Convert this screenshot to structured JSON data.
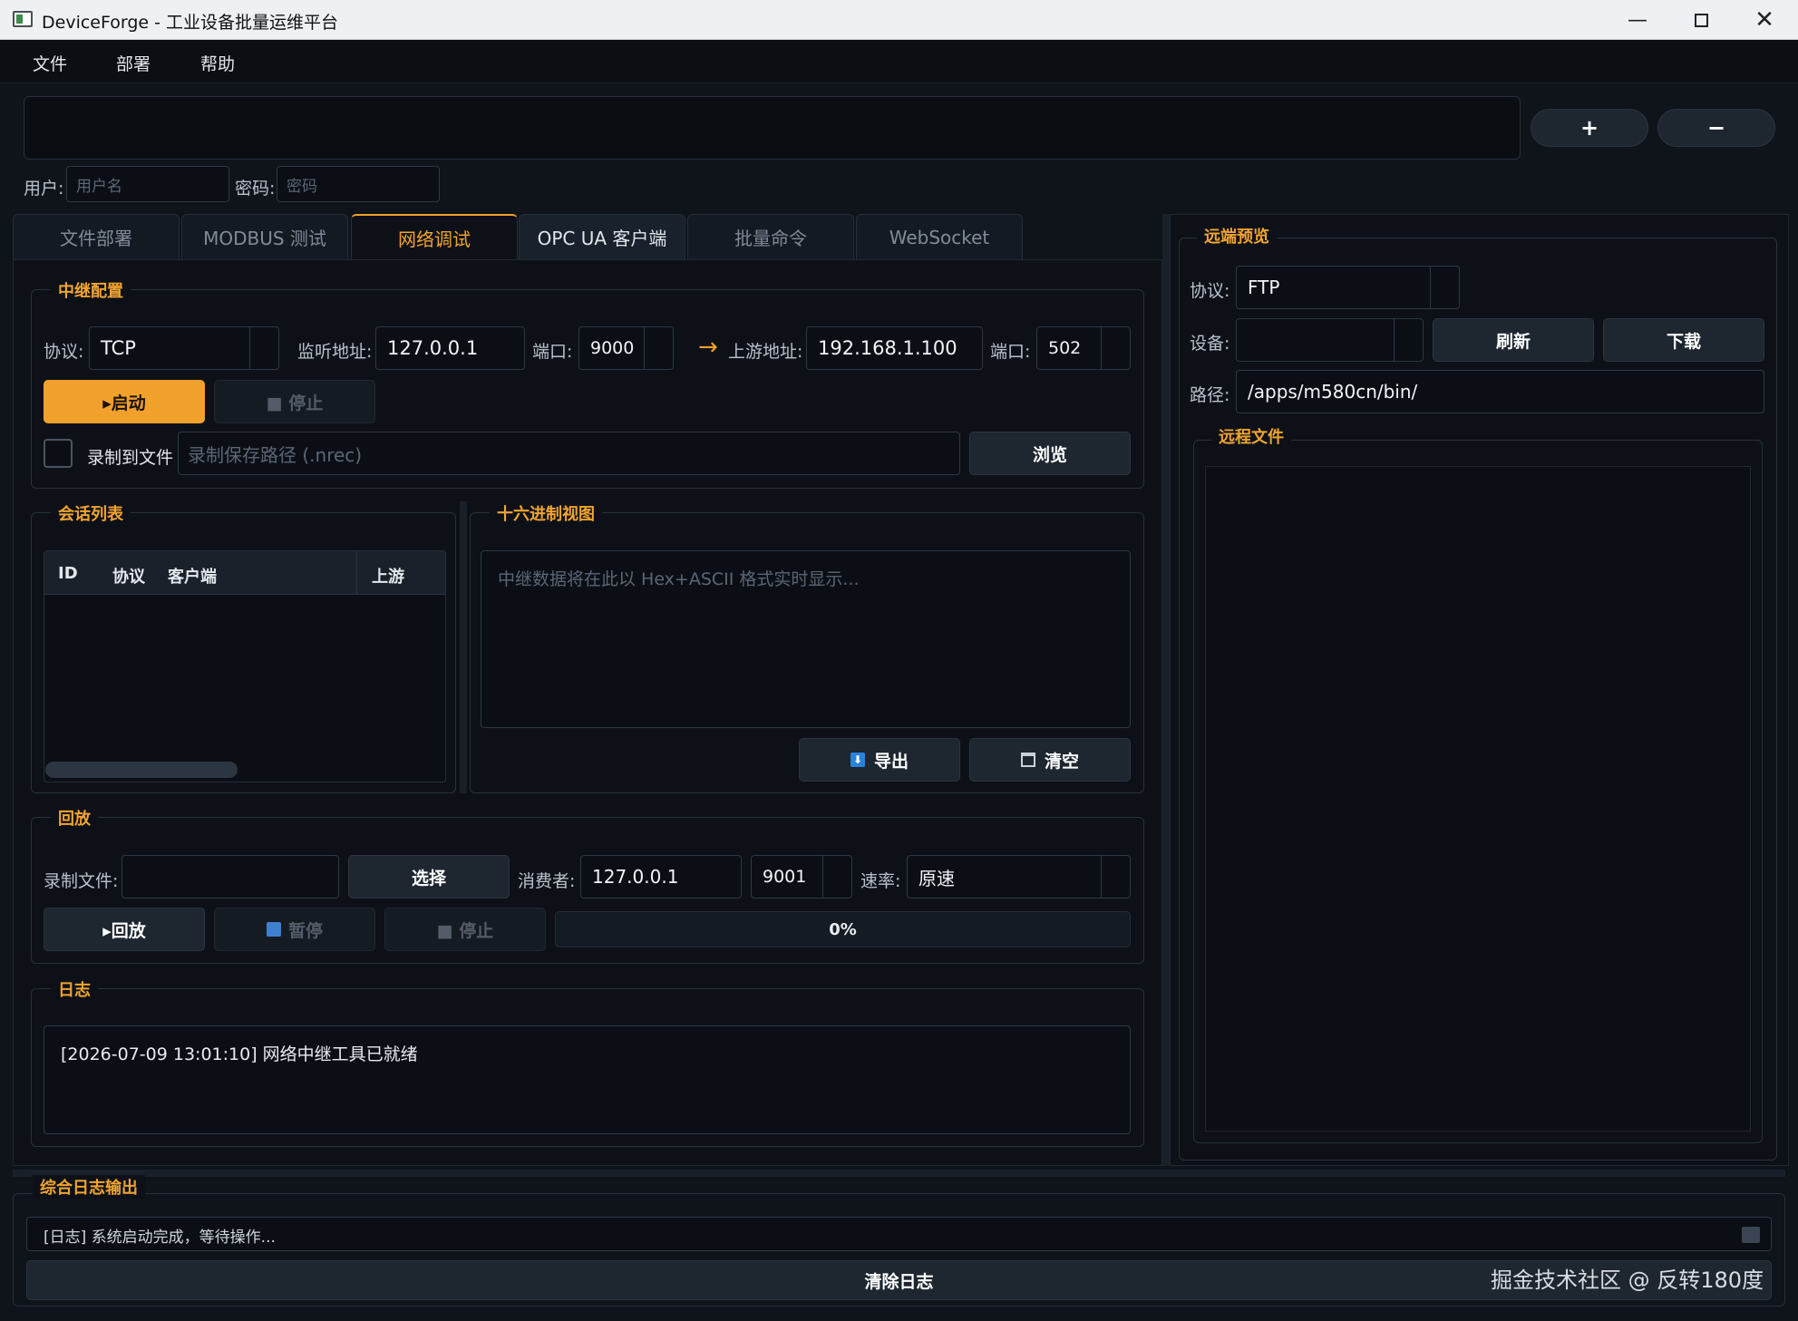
{
  "window": {
    "title": "DeviceForge - 工业设备批量运维平台"
  },
  "menu": [
    "文件",
    "部署",
    "帮助"
  ],
  "device_bar": {
    "add_label": "+",
    "remove_label": "−",
    "user_label": "用户:",
    "user_placeholder": "用户名",
    "password_label": "密码:",
    "password_placeholder": "密码"
  },
  "tabs": [
    {
      "label": "文件部署"
    },
    {
      "label": "MODBUS 测试"
    },
    {
      "label": "网络调试"
    },
    {
      "label": "OPC UA 客户端"
    },
    {
      "label": "批量命令"
    },
    {
      "label": "WebSocket"
    }
  ],
  "relay": {
    "title": "中继配置",
    "protocol_label": "协议:",
    "protocol_value": "TCP",
    "listen_label": "监听地址:",
    "listen_value": "127.0.0.1",
    "port_label": "端口:",
    "port_value": "9000",
    "arrow": "→",
    "upstream_label": "上游地址:",
    "upstream_value": "192.168.1.100",
    "upstream_port_label": "端口:",
    "upstream_port_value": "502",
    "start_label": "▸启动",
    "stop_label": "■ 停止",
    "record_label": "录制到文件",
    "record_placeholder": "录制保存路径 (.nrec)",
    "browse_label": "浏览"
  },
  "sessions": {
    "title": "会话列表",
    "columns": [
      "ID",
      "协议",
      "客户端",
      "上游"
    ]
  },
  "hex": {
    "title": "十六进制视图",
    "placeholder": "中继数据将在此以 Hex+ASCII 格式实时显示...",
    "export_label": "导出",
    "clear_label": "清空"
  },
  "replay": {
    "title": "回放",
    "file_label": "录制文件:",
    "select_label": "选择",
    "consumer_label": "消费者:",
    "consumer_host": "127.0.0.1",
    "consumer_port": "9001",
    "speed_label": "速率:",
    "speed_value": "原速",
    "play_label": "▸回放",
    "pause_label": "暂停",
    "stop_label": "■ 停止",
    "progress_text": "0%",
    "progress": 0
  },
  "log": {
    "title": "日志",
    "lines": [
      "[2026-07-09 13:01:10] 网络中继工具已就绪"
    ]
  },
  "remote": {
    "title": "远端预览",
    "protocol_label": "协议:",
    "protocol_value": "FTP",
    "device_label": "设备:",
    "refresh_label": "刷新",
    "download_label": "下载",
    "path_label": "路径:",
    "path_value": "/apps/m580cn/bin/",
    "files_title": "远程文件"
  },
  "global_log": {
    "title": "综合日志输出",
    "line": "[日志] 系统启动完成，等待操作...",
    "clear_label": "清除日志",
    "watermark": "掘金技术社区 @ 反转180度"
  },
  "colors": {
    "accent": "#f0a12c",
    "background": "#0f131a",
    "panel": "#0d1117"
  }
}
